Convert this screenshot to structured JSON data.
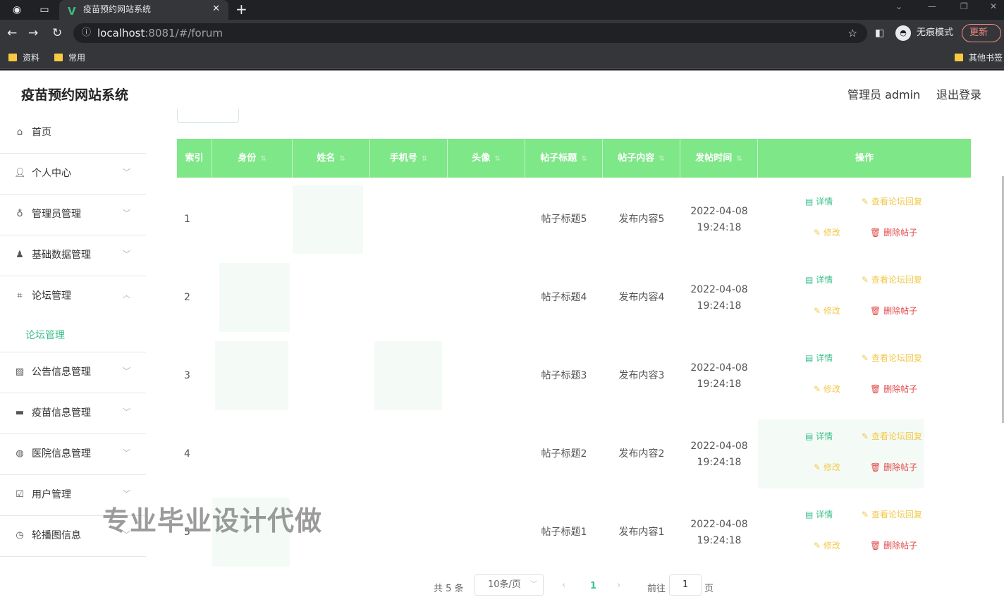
{
  "browser": {
    "tab_title": "疫苗预约网站系统",
    "url_host": "localhost",
    "url_rest": ":8081/#/forum",
    "incognito_label": "无痕模式",
    "update_label": "更新",
    "bookmarks": [
      "资料",
      "常用"
    ],
    "other_bookmarks": "其他书签"
  },
  "header": {
    "title": "疫苗预约网站系统",
    "admin_label": "管理员 admin",
    "logout_label": "退出登录"
  },
  "sidebar": {
    "items": [
      {
        "label": "首页",
        "icon": "home-icon"
      },
      {
        "label": "个人中心",
        "icon": "user-icon"
      },
      {
        "label": "管理员管理",
        "icon": "mic-icon"
      },
      {
        "label": "基础数据管理",
        "icon": "person-icon"
      },
      {
        "label": "论坛管理",
        "icon": "crop-icon"
      },
      {
        "label": "公告信息管理",
        "icon": "chart-icon"
      },
      {
        "label": "疫苗信息管理",
        "icon": "monitor-icon"
      },
      {
        "label": "医院信息管理",
        "icon": "globe-icon"
      },
      {
        "label": "用户管理",
        "icon": "check-icon"
      },
      {
        "label": "轮播图信息",
        "icon": "compass-icon"
      }
    ],
    "submenu_label": "论坛管理"
  },
  "watermark": "专业毕业设计代做",
  "table": {
    "columns": [
      "索引",
      "身份",
      "姓名",
      "手机号",
      "头像",
      "帖子标题",
      "帖子内容",
      "发帖时间",
      "操作"
    ],
    "rows": [
      {
        "index": "1",
        "title": "帖子标题5",
        "content": "发布内容5",
        "date": "2022-04-08",
        "time": "19:24:18"
      },
      {
        "index": "2",
        "title": "帖子标题4",
        "content": "发布内容4",
        "date": "2022-04-08",
        "time": "19:24:18"
      },
      {
        "index": "3",
        "title": "帖子标题3",
        "content": "发布内容3",
        "date": "2022-04-08",
        "time": "19:24:18"
      },
      {
        "index": "4",
        "title": "帖子标题2",
        "content": "发布内容2",
        "date": "2022-04-08",
        "time": "19:24:18"
      },
      {
        "index": "5",
        "title": "帖子标题1",
        "content": "发布内容1",
        "date": "2022-04-08",
        "time": "19:24:18"
      }
    ],
    "actions": {
      "detail": "详情",
      "reply": "查看论坛回复",
      "edit": "修改",
      "delete": "删除帖子"
    }
  },
  "pagination": {
    "total": "共 5 条",
    "page_size": "10条/页",
    "current": "1",
    "goto_label": "前往",
    "goto_value": "1",
    "page_suffix": "页"
  }
}
